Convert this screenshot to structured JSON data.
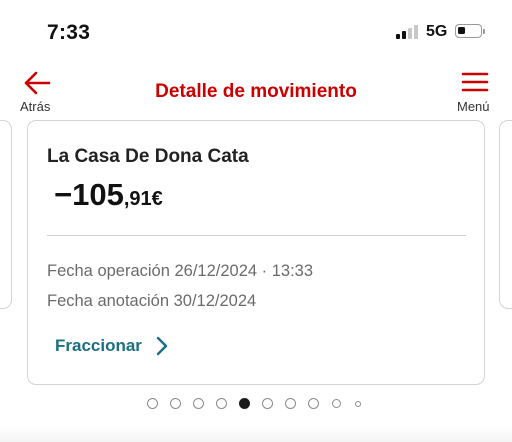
{
  "status_bar": {
    "time": "7:33",
    "network": "5G",
    "signal_bars_active": 2,
    "battery_level": 0.25
  },
  "header": {
    "back_label": "Atrás",
    "title": "Detalle de movimiento",
    "menu_label": "Menú",
    "accent_color": "#cc0000"
  },
  "card": {
    "merchant": "La Casa De Dona Cata",
    "amount_integer": "−105",
    "amount_decimal": ",91€",
    "operation_date_line": "Fecha operación 26/12/2024 · 13:33",
    "posting_date_line": "Fecha anotación 30/12/2024",
    "fraccionar_label": "Fraccionar",
    "link_color": "#1a6f82"
  },
  "pagination": {
    "total_dots": 10,
    "active_index": 4
  },
  "icons": {
    "back": "arrow-left-icon",
    "menu": "hamburger-menu-icon",
    "fraccionar": "chevron-right-icon"
  }
}
